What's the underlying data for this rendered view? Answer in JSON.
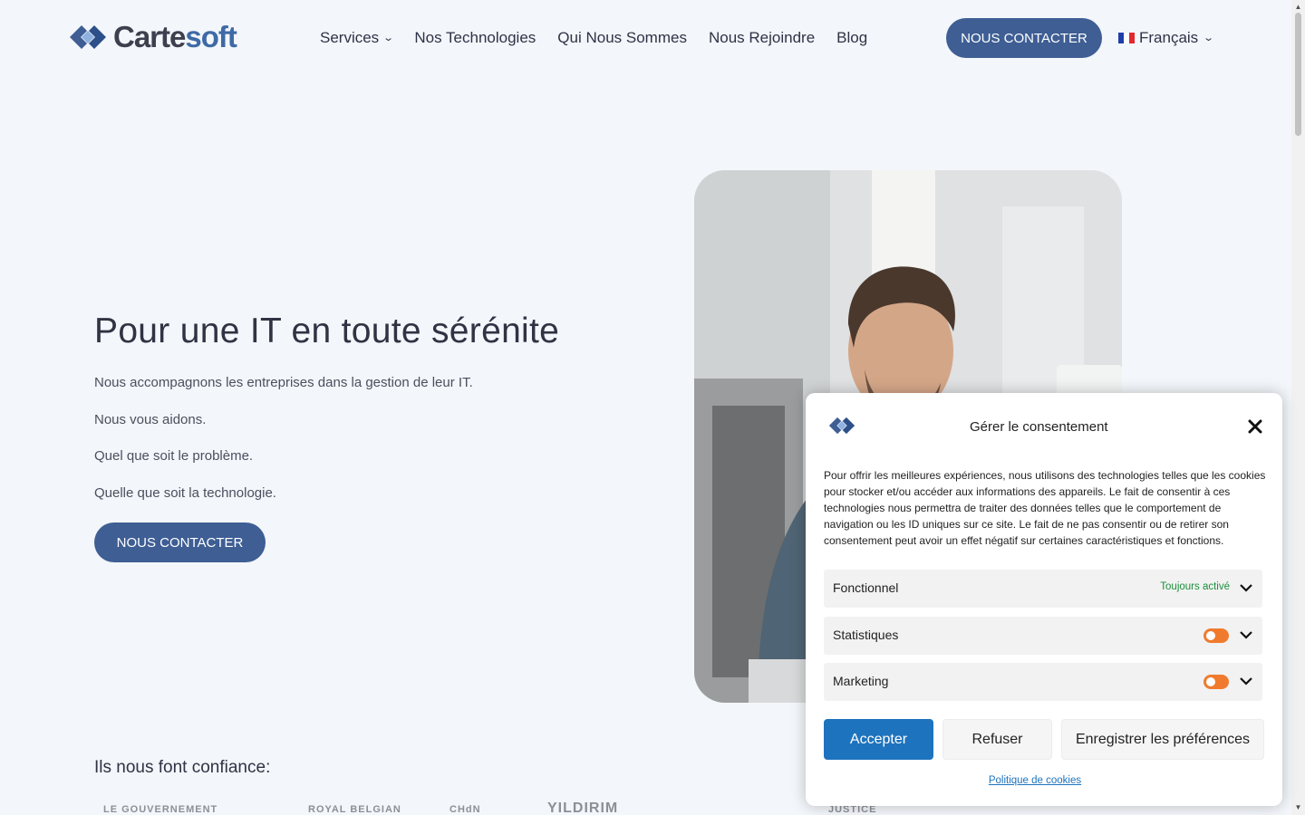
{
  "header": {
    "logo": {
      "part1": "Carte",
      "part2": "soft"
    },
    "nav": [
      {
        "label": "Services",
        "has_dropdown": true
      },
      {
        "label": "Nos Technologies",
        "has_dropdown": false
      },
      {
        "label": "Qui Nous Sommes",
        "has_dropdown": false
      },
      {
        "label": "Nous Rejoindre",
        "has_dropdown": false
      },
      {
        "label": "Blog",
        "has_dropdown": false
      }
    ],
    "cta_label": "NOUS CONTACTER",
    "language": {
      "label": "Français",
      "flag": "flag-fr-icon"
    }
  },
  "hero": {
    "title": "Pour une IT en toute sérénite",
    "paragraphs": [
      "Nous accompagnons les entreprises dans la gestion de leur IT.",
      "Nous vous aidons.",
      "Quel que soit le problème.",
      "Quelle que soit la technologie."
    ],
    "cta_label": "NOUS CONTACTER",
    "image": "man-smiling-at-laptop-photo"
  },
  "trust": {
    "title": "Ils nous font confiance:",
    "clients": [
      "LE GOUVERNEMENT",
      "ROYAL BELGIAN",
      "CHdN",
      "YILDIRIM",
      "",
      "JUSTICE",
      ""
    ]
  },
  "consent_modal": {
    "title": "Gérer le consentement",
    "description": "Pour offrir les meilleures expériences, nous utilisons des technologies telles que les cookies pour stocker et/ou accéder aux informations des appareils. Le fait de consentir à ces technologies nous permettra de traiter des données telles que le comportement de navigation ou les ID uniques sur ce site. Le fait de ne pas consentir ou de retirer son consentement peut avoir un effet négatif sur certaines caractéristiques et fonctions.",
    "categories": [
      {
        "label": "Fonctionnel",
        "status": "Toujours activé"
      },
      {
        "label": "Statistiques",
        "toggle": "off"
      },
      {
        "label": "Marketing",
        "toggle": "off"
      }
    ],
    "buttons": {
      "accept": "Accepter",
      "refuse": "Refuser",
      "save": "Enregistrer les préférences"
    },
    "policy_link": "Politique de cookies"
  },
  "colors": {
    "page_bg": "#f3f6fa",
    "brand_blue": "#3e5e94",
    "accent_blue": "#1e73be",
    "toggle_off": "#f07b2e",
    "always_on_green": "#1b8f3a"
  }
}
